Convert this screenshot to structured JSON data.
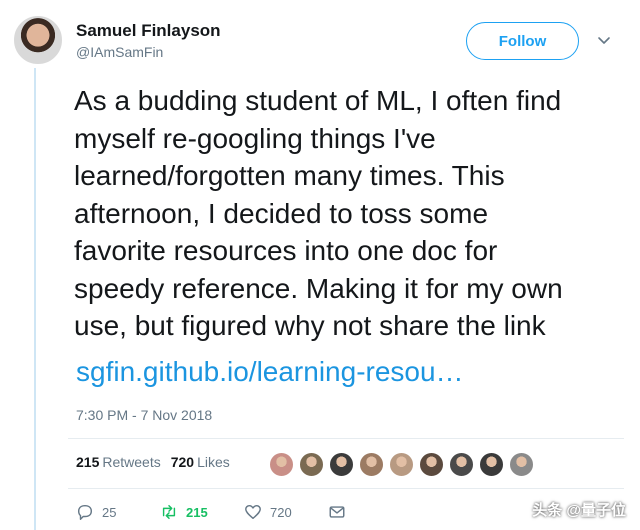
{
  "author": {
    "name": "Samuel Finlayson",
    "handle": "@IAmSamFin",
    "follow_label": "Follow"
  },
  "tweet": {
    "lines": [
      "As a budding student of ML, I often find",
      "myself re-googling things I've",
      "learned/forgotten many times. This",
      "afternoon, I decided to toss some",
      "favorite resources into one doc for",
      "speedy reference. Making it for my own",
      "use, but figured why not share the link"
    ],
    "link": "sgfin.github.io/learning-resou…",
    "timestamp": "7:30 PM - 7 Nov 2018"
  },
  "stats": {
    "retweets_count": "215",
    "retweets_label": "Retweets",
    "likes_count": "720",
    "likes_label": "Likes",
    "liker_colors": [
      "#c98f87",
      "#7a6a52",
      "#3b3b3b",
      "#9c7b63",
      "#b89a82",
      "#5b4a3e",
      "#4a4a4a",
      "#3a3a3a",
      "#8a8a8a"
    ]
  },
  "actions": {
    "replies": "25",
    "retweets": "215",
    "likes": "720"
  },
  "watermark": "头条 @量子位",
  "colors": {
    "accent": "#1da1f2",
    "link": "#1b95e0",
    "retweet": "#17bf63"
  }
}
